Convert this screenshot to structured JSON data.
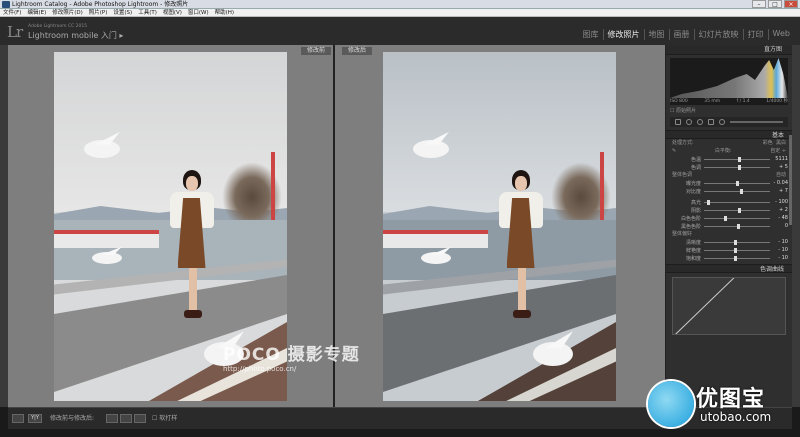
{
  "window": {
    "title": "Lightroom Catalog - Adobe Photoshop Lightroom - 修改照片"
  },
  "menu": [
    "文件(F)",
    "编辑(E)",
    "修改照片(D)",
    "照片(P)",
    "设置(S)",
    "工具(T)",
    "视图(V)",
    "窗口(W)",
    "帮助(H)"
  ],
  "identity": {
    "small": "Adobe Lightroom CC 2015",
    "plate": "Lightroom mobile 入门 ▸"
  },
  "modules": [
    "图库",
    "修改照片",
    "地图",
    "画册",
    "幻灯片放映",
    "打印",
    "Web"
  ],
  "active_module": "修改照片",
  "view": {
    "before_label": "修改前",
    "after_label": "修改后"
  },
  "watermark": {
    "brand": "POCO 摄影专题",
    "url": "http://photo.poco.cn/"
  },
  "panel": {
    "histogram_label": "直方图",
    "exif": [
      "ISO 800",
      "35 mm",
      "f / 1.4",
      "1/4000 秒"
    ],
    "original_photo": "原始照片",
    "basic_label": "基本",
    "treatment": {
      "label": "处理方式:",
      "color": "彩色",
      "bw": "黑白"
    },
    "wb": {
      "label": "白平衡:",
      "value": "自定 ÷"
    },
    "temp": {
      "label": "色温",
      "value": "5111",
      "pos": 0.52
    },
    "tint": {
      "label": "色调",
      "value": "+ 5",
      "pos": 0.52
    },
    "tone_label": "整体色调",
    "auto": "自动",
    "tone": [
      {
        "label": "曝光度",
        "value": "- 0.04",
        "pos": 0.49
      },
      {
        "label": "对比度",
        "value": "+ 7",
        "pos": 0.55
      }
    ],
    "lights": [
      {
        "label": "高光",
        "value": "- 100",
        "pos": 0.05
      },
      {
        "label": "阴影",
        "value": "+ 2",
        "pos": 0.51
      },
      {
        "label": "白色色阶",
        "value": "- 48",
        "pos": 0.3
      },
      {
        "label": "黑色色阶",
        "value": "0",
        "pos": 0.5
      }
    ],
    "presence_label": "整体偏好",
    "presence": [
      {
        "label": "清晰度",
        "value": "- 10",
        "pos": 0.45
      },
      {
        "label": "鲜艳度",
        "value": "- 10",
        "pos": 0.45
      },
      {
        "label": "饱和度",
        "value": "- 10",
        "pos": 0.45
      }
    ],
    "curve_label": "色调曲线"
  },
  "toolbar": {
    "view_btn": "Y|Y",
    "swap_label": "修改前与修改后:",
    "softproof": "软打样"
  },
  "logo": {
    "cn": "优图宝",
    "en": "utobao.com"
  }
}
